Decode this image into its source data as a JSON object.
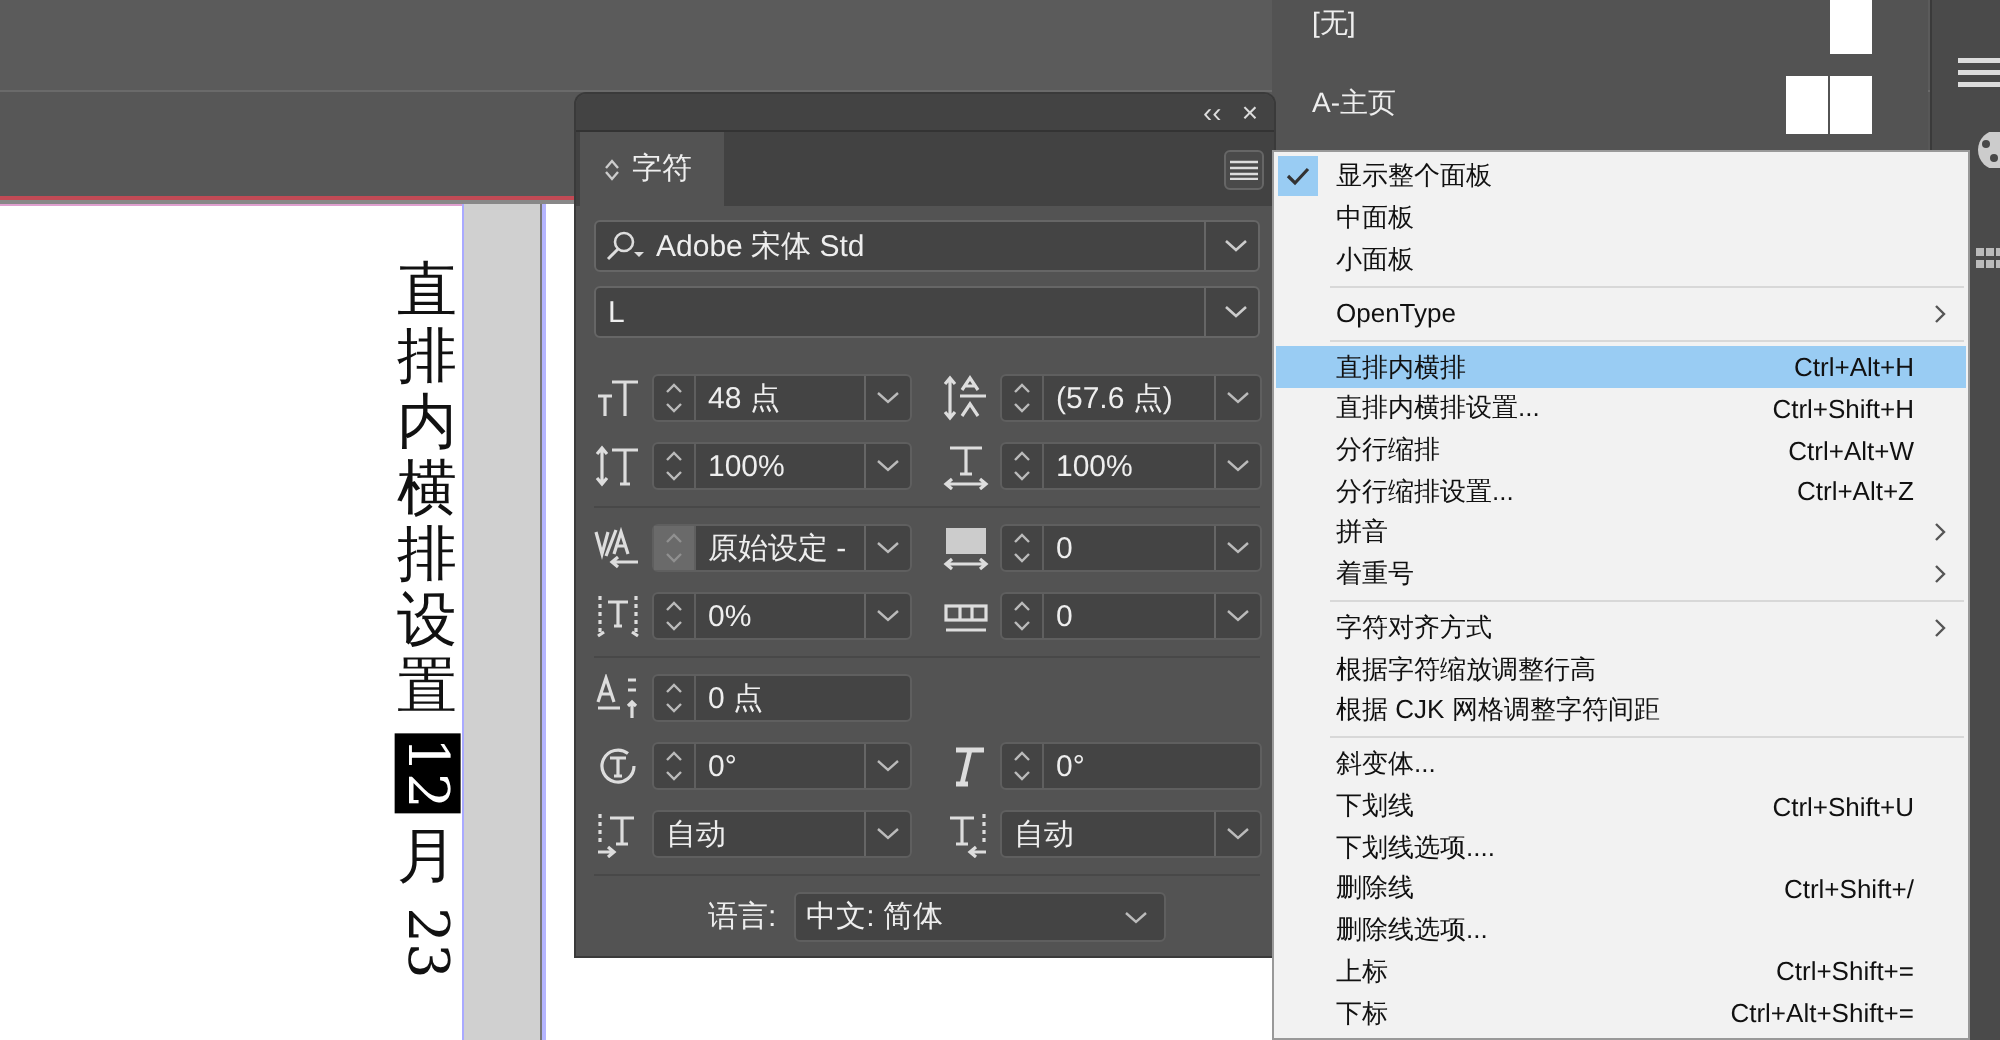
{
  "pages_panel": {
    "items": [
      {
        "label": "[无]",
        "kind": "single"
      },
      {
        "label": "A-主页",
        "kind": "spread"
      }
    ]
  },
  "document": {
    "segments": [
      {
        "text": "直排内横排设置",
        "kind": "upright",
        "selected": false
      },
      {
        "text": "12",
        "kind": "rotated",
        "selected": true
      },
      {
        "text": "月",
        "kind": "upright",
        "selected": false
      },
      {
        "text": "23",
        "kind": "rotated",
        "selected": false
      }
    ]
  },
  "character_panel": {
    "header_buttons": [
      "‹‹",
      "×"
    ],
    "tab": {
      "label": "字符",
      "selected": true
    },
    "font_family": "Adobe 宋体 Std",
    "font_style": "L",
    "groups": [
      [
        [
          {
            "value": "48 点",
            "kind": "spin-combo",
            "disabled": false
          },
          {
            "value": "(57.6 点)",
            "kind": "spin-combo",
            "disabled": false
          }
        ],
        [
          {
            "value": "100%",
            "kind": "spin-combo",
            "disabled": false
          },
          {
            "value": "100%",
            "kind": "spin-combo",
            "disabled": false
          }
        ]
      ],
      [
        [
          {
            "value": "原始设定 -",
            "kind": "spin-combo",
            "disabled": true
          },
          {
            "value": "0",
            "kind": "spin-combo",
            "disabled": false
          }
        ],
        [
          {
            "value": "0%",
            "kind": "spin-combo",
            "disabled": false
          },
          {
            "value": "0",
            "kind": "spin-combo",
            "disabled": false
          }
        ]
      ],
      [
        [
          {
            "value": "0 点",
            "kind": "spin",
            "disabled": false
          }
        ],
        [
          {
            "value": "0°",
            "kind": "spin-combo",
            "disabled": false
          },
          {
            "value": "0°",
            "kind": "spin",
            "disabled": false
          }
        ],
        [
          {
            "value": "自动",
            "kind": "combo",
            "disabled": false
          },
          {
            "value": "自动",
            "kind": "combo",
            "disabled": false
          }
        ]
      ]
    ],
    "language": {
      "label": "语言:",
      "value": "中文: 简体"
    }
  },
  "menu": {
    "groups": [
      [
        {
          "label": "显示整个面板",
          "checked": true,
          "selected": false,
          "submenu": false
        },
        {
          "label": "中面板",
          "checked": false,
          "selected": false,
          "submenu": false
        },
        {
          "label": "小面板",
          "checked": false,
          "selected": false,
          "submenu": false
        }
      ],
      [
        {
          "label": "OpenType",
          "checked": false,
          "selected": false,
          "submenu": true
        }
      ],
      [
        {
          "label": "直排内横排",
          "shortcut": "Ctrl+Alt+H",
          "checked": false,
          "selected": true,
          "submenu": false
        },
        {
          "label": "直排内横排设置...",
          "shortcut": "Ctrl+Shift+H",
          "checked": false,
          "selected": false,
          "submenu": false
        },
        {
          "label": "分行缩排",
          "shortcut": "Ctrl+Alt+W",
          "checked": false,
          "selected": false,
          "submenu": false
        },
        {
          "label": "分行缩排设置...",
          "shortcut": "Ctrl+Alt+Z",
          "checked": false,
          "selected": false,
          "submenu": false
        },
        {
          "label": "拼音",
          "checked": false,
          "selected": false,
          "submenu": true
        },
        {
          "label": "着重号",
          "checked": false,
          "selected": false,
          "submenu": true
        }
      ],
      [
        {
          "label": "字符对齐方式",
          "checked": false,
          "selected": false,
          "submenu": true
        },
        {
          "label": "根据字符缩放调整行高",
          "checked": false,
          "selected": false,
          "submenu": false
        },
        {
          "label": "根据 CJK 网格调整字符间距",
          "checked": false,
          "selected": false,
          "submenu": false
        }
      ],
      [
        {
          "label": "斜变体...",
          "checked": false,
          "selected": false,
          "submenu": false
        },
        {
          "label": "下划线",
          "shortcut": "Ctrl+Shift+U",
          "checked": false,
          "selected": false,
          "submenu": false
        },
        {
          "label": "下划线选项....",
          "checked": false,
          "selected": false,
          "submenu": false
        },
        {
          "label": "删除线",
          "shortcut": "Ctrl+Shift+/",
          "checked": false,
          "selected": false,
          "submenu": false
        },
        {
          "label": "删除线选项...",
          "checked": false,
          "selected": false,
          "submenu": false
        },
        {
          "label": "上标",
          "shortcut": "Ctrl+Shift+=",
          "checked": false,
          "selected": false,
          "submenu": false
        },
        {
          "label": "下标",
          "shortcut": "Ctrl+Alt+Shift+=",
          "checked": false,
          "selected": false,
          "submenu": false
        }
      ]
    ]
  }
}
